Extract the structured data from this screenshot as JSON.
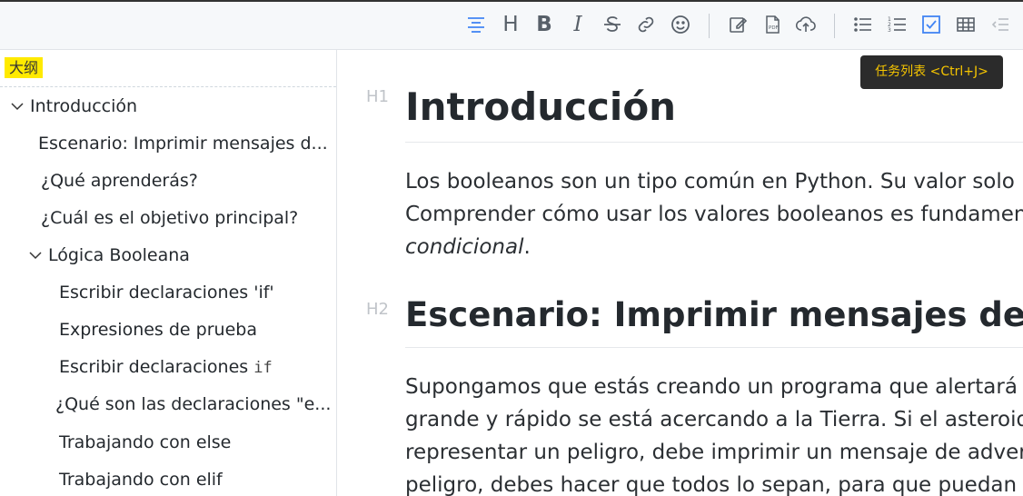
{
  "toolbar": {
    "buttons": [
      {
        "id": "align-center",
        "icon": "align-center-icon"
      },
      {
        "id": "heading",
        "icon": "heading-icon",
        "text": "H"
      },
      {
        "id": "bold",
        "icon": "bold-icon",
        "text": "B"
      },
      {
        "id": "italic",
        "icon": "italic-icon",
        "text": "I"
      },
      {
        "id": "strikethrough",
        "icon": "strikethrough-icon"
      },
      {
        "id": "link",
        "icon": "link-icon"
      },
      {
        "id": "emoji",
        "icon": "emoji-icon"
      },
      {
        "id": "edit",
        "icon": "edit-icon"
      },
      {
        "id": "pdf",
        "icon": "pdf-icon"
      },
      {
        "id": "upload",
        "icon": "cloud-upload-icon"
      },
      {
        "id": "bullet-list",
        "icon": "bullet-list-icon"
      },
      {
        "id": "ordered-list",
        "icon": "ordered-list-icon"
      },
      {
        "id": "task-list",
        "icon": "task-list-icon"
      },
      {
        "id": "table",
        "icon": "table-icon"
      },
      {
        "id": "outdent",
        "icon": "outdent-icon"
      }
    ],
    "accent_color": "#4285f4",
    "heading_text": "H",
    "bold_text": "B",
    "italic_text": "I"
  },
  "tooltip": {
    "text": "任务列表 <Ctrl+J>"
  },
  "sidebar": {
    "title": "大纲",
    "items": [
      {
        "label": "Introducción",
        "level": 1,
        "collapsible": true
      },
      {
        "label": "Escenario: Imprimir mensajes d...",
        "level": 2
      },
      {
        "label": "¿Qué aprenderás?",
        "level": 2
      },
      {
        "label": "¿Cuál es el objetivo principal?",
        "level": 2
      },
      {
        "label": "Lógica Booleana",
        "level": 2,
        "collapsible": true
      },
      {
        "label": "Escribir declaraciones 'if'",
        "level": 3
      },
      {
        "label": "Expresiones de prueba",
        "level": 3
      },
      {
        "label": "Escribir declaraciones ",
        "code": "if",
        "level": 3
      },
      {
        "label": "¿Qué son las declaraciones \"e...",
        "level": 3
      },
      {
        "label": "Trabajando con else",
        "level": 3
      },
      {
        "label": "Trabajando con elif",
        "level": 3
      }
    ]
  },
  "content": {
    "h1_label": "H1",
    "h1": "Introducción",
    "p1": [
      "Los booleanos son un tipo común en Python. Su valor solo",
      "Comprender cómo usar los valores booleanos es fundamen",
      "condicional",
      "."
    ],
    "h2_label": "H2",
    "h2": "Escenario: Imprimir mensajes de adv",
    "p2": [
      "Supongamos que estás creando un programa que alertará a",
      "grande y rápido se está acercando a la Tierra. Si el asteroide",
      "representar un peligro, debe imprimir un mensaje de advert",
      "peligro, debes hacer que todos lo sepan, para que puedan e"
    ]
  }
}
